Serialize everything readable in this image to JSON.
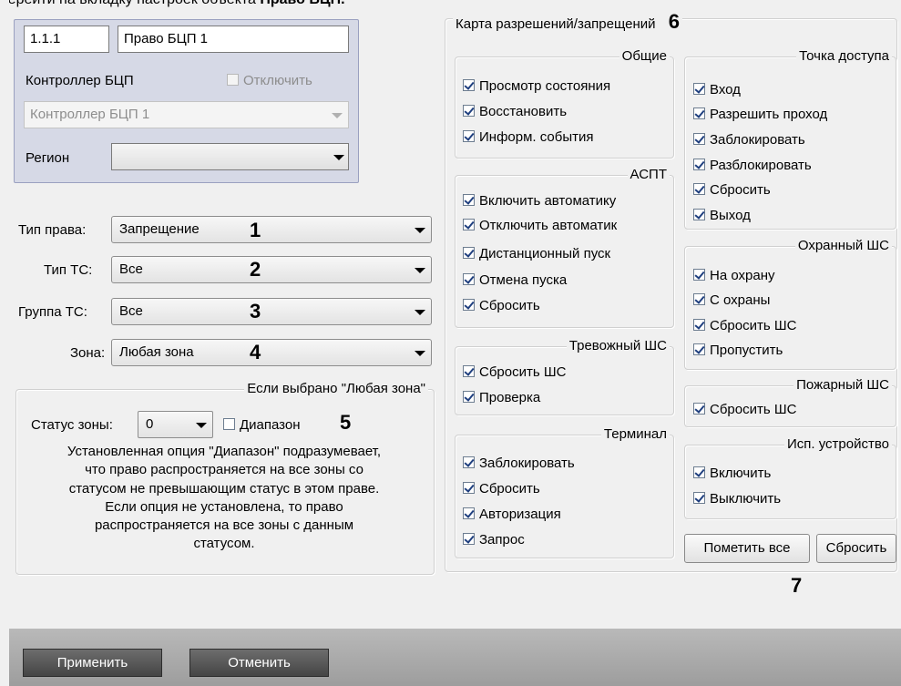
{
  "instruction": {
    "prefix": "перейти на вкладку настроек объекта",
    "bold": "Право БЦП."
  },
  "header": {
    "number": "1.1.1",
    "name": "Право БЦП 1"
  },
  "controller": {
    "label": "Контроллер БЦП",
    "disable_label": "Отключить",
    "value": "Контроллер БЦП 1"
  },
  "region": {
    "label": "Регион",
    "value": ""
  },
  "fields": {
    "right_type": {
      "label": "Тип права:",
      "value": "Запрещение",
      "marker": "1"
    },
    "ts_type": {
      "label": "Тип ТС:",
      "value": "Все",
      "marker": "2"
    },
    "ts_group": {
      "label": "Группа ТС:",
      "value": "Все",
      "marker": "3"
    },
    "zone": {
      "label": "Зона:",
      "value": "Любая зона",
      "marker": "4"
    }
  },
  "anyzone": {
    "title": "Если выбрано \"Любая зона\"",
    "status_label": "Статус зоны:",
    "status_value": "0",
    "range_label": "Диапазон",
    "marker": "5",
    "note": [
      "Установленная опция \"Диапазон\" подразумевает,",
      "что право распространяется на все зоны со",
      "статусом не превышающим статус в этом праве.",
      "Если опция не установлена, то право",
      "распространяется на все зоны с данным",
      "статусом."
    ]
  },
  "map": {
    "title": "Карта разрешений/запрещений",
    "marker": "6",
    "groups": {
      "common": {
        "title": "Общие",
        "items": [
          "Просмотр состояния",
          "Восстановить",
          "Информ. события"
        ]
      },
      "aspt": {
        "title": "АСПТ",
        "items": [
          "Включить автоматику",
          "Отключить автоматик",
          "Дистанционный пуск",
          "Отмена пуска",
          "Сбросить"
        ]
      },
      "alarm": {
        "title": "Тревожный ШС",
        "items": [
          "Сбросить ШС",
          "Проверка"
        ]
      },
      "terminal": {
        "title": "Терминал",
        "items": [
          "Заблокировать",
          "Сбросить",
          "Авторизация",
          "Запрос"
        ]
      },
      "access_point": {
        "title": "Точка доступа",
        "items": [
          "Вход",
          "Разрешить проход",
          "Заблокировать",
          "Разблокировать",
          "Сбросить",
          "Выход"
        ]
      },
      "security": {
        "title": "Охранный ШС",
        "items": [
          "На охрану",
          "С охраны",
          "Сбросить ШС",
          "Пропустить"
        ]
      },
      "fire": {
        "title": "Пожарный ШС",
        "items": [
          "Сбросить ШС"
        ]
      },
      "actuator": {
        "title": "Исп. устройство",
        "items": [
          "Включить",
          "Выключить"
        ]
      }
    },
    "mark_all": "Пометить все",
    "reset": "Сбросить",
    "marker7": "7"
  },
  "footer": {
    "apply": "Применить",
    "cancel": "Отменить"
  }
}
